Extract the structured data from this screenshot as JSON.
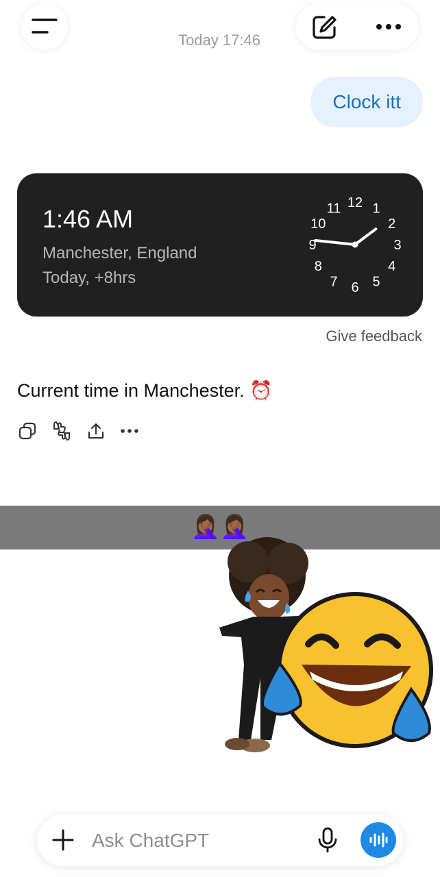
{
  "header": {
    "timestamp": "Today 17:46"
  },
  "conversation": {
    "user_message": "Clock itt",
    "clock_widget": {
      "time": "1:46 AM",
      "location": "Manchester, England",
      "offset": "Today, +8hrs",
      "dial_numbers": [
        "12",
        "1",
        "2",
        "3",
        "4",
        "5",
        "6",
        "7",
        "8",
        "9",
        "10",
        "11"
      ],
      "hour_hand": 1.77,
      "minute_hand": 46
    },
    "feedback_label": "Give feedback",
    "assistant_message": "Current time in Manchester. ⏰"
  },
  "overlay": {
    "emoji_text": "🤦🏾‍♀️🤦🏾‍♀️"
  },
  "composer": {
    "placeholder": "Ask ChatGPT"
  },
  "colors": {
    "accent": "#1e88e5",
    "bubble": "#e5f1fc",
    "card": "#202020"
  }
}
